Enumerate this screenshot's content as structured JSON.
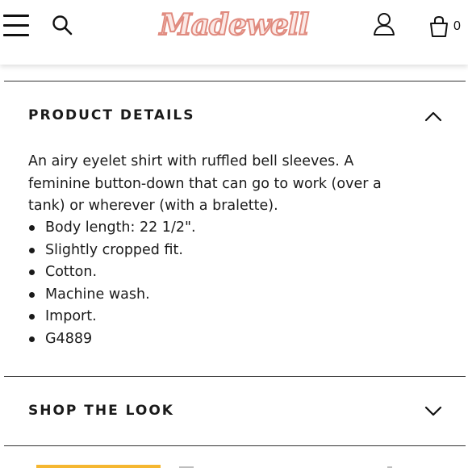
{
  "header": {
    "logo_text": "Madewell",
    "bag_count": "0",
    "icons": [
      "menu-icon",
      "search-icon",
      "user-icon",
      "shopping-bag-icon"
    ]
  },
  "product_details": {
    "title": "PRODUCT DETAILS",
    "expanded": true,
    "description": "An airy eyelet shirt with ruffled bell sleeves. A feminine button-down that can go to work (over a tank) or wherever (with a bralette).",
    "bullets": [
      "Body length: 22 1/2\".",
      "Slightly cropped fit.",
      "Cotton.",
      "Machine wash.",
      "Import.",
      "G4889"
    ]
  },
  "shop_the_look": {
    "title": "SHOP THE LOOK",
    "expanded": false
  },
  "colors": {
    "logo_fill": "#fbe9e6",
    "logo_outline": "#e08a7e",
    "accent_yellow": "#f5b731",
    "text": "#1a1a1a"
  }
}
